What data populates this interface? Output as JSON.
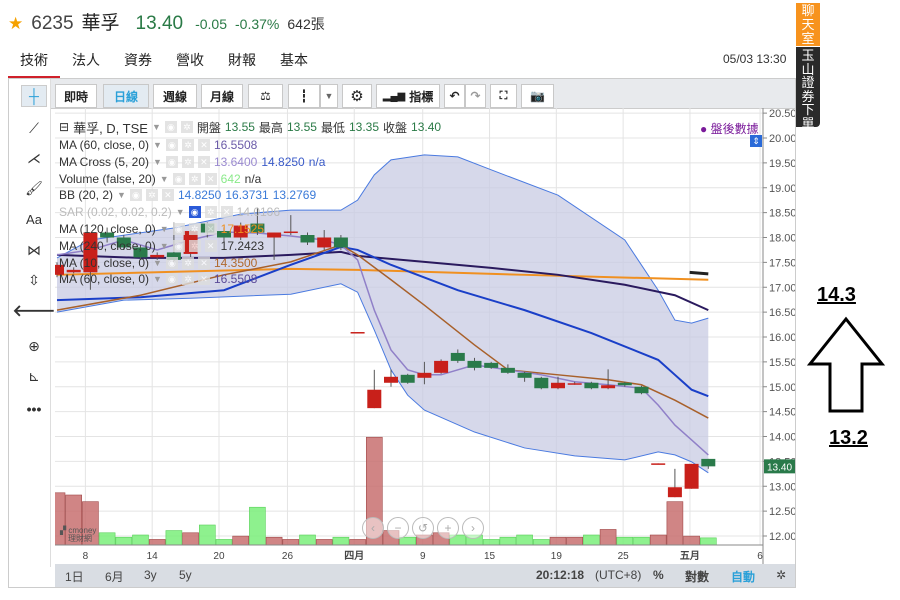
{
  "header": {
    "code": "6235",
    "name": "華孚",
    "price": "13.40",
    "change": "-0.05",
    "change_pct": "-0.37%",
    "volume": "642張"
  },
  "tabs": [
    "技術",
    "法人",
    "資券",
    "營收",
    "財報",
    "基本"
  ],
  "datetime": "05/03 13:30",
  "toolbar": {
    "realtime": "即時",
    "daily": "日線",
    "weekly": "週線",
    "monthly": "月線",
    "indicators": "指標"
  },
  "side": {
    "chat": "聊天室",
    "order": "玉山證券下單"
  },
  "after_hours": "盤後數據",
  "legend": {
    "main": {
      "title": "華孚, D, TSE",
      "open_label": "開盤",
      "open": "13.55",
      "high_label": "最高",
      "high": "13.55",
      "low_label": "最低",
      "low": "13.35",
      "close_label": "收盤",
      "close": "13.40"
    },
    "rows": [
      {
        "name": "MA (60, close, 0)",
        "values": [
          {
            "v": "16.5508",
            "c": "#6a5aa8"
          }
        ]
      },
      {
        "name": "MA Cross (5, 20)",
        "values": [
          {
            "v": "13.6400",
            "c": "#9a8ad0"
          },
          {
            "v": "14.8250",
            "c": "#3a5ac8"
          },
          {
            "v": "n/a",
            "c": "#3a5ac8"
          }
        ]
      },
      {
        "name": "Volume (false, 20)",
        "values": [
          {
            "v": "642",
            "c": "#8aea8a"
          },
          {
            "v": "n/a",
            "c": "#333"
          }
        ]
      },
      {
        "name": "BB (20, 2)",
        "values": [
          {
            "v": "14.8250",
            "c": "#3a7ad8"
          },
          {
            "v": "16.3731",
            "c": "#3a7ad8"
          },
          {
            "v": "13.2769",
            "c": "#3a7ad8"
          }
        ]
      },
      {
        "name": "SAR (0.02, 0.02, 0.2)",
        "values": [
          {
            "v": "14.0106",
            "c": "#bbb"
          }
        ],
        "dim": true
      },
      {
        "name": "MA (120, close, 0)",
        "values": [
          {
            "v": "17.1525",
            "c": "#f09020"
          }
        ]
      },
      {
        "name": "MA (240, close, 0)",
        "values": [
          {
            "v": "17.2423",
            "c": "#333"
          }
        ]
      },
      {
        "name": "MA (10, close, 0)",
        "values": [
          {
            "v": "14.3500",
            "c": "#b06a30"
          }
        ]
      },
      {
        "name": "MA (60, close, 0)",
        "values": [
          {
            "v": "16.5508",
            "c": "#5a4a98"
          }
        ]
      }
    ]
  },
  "bottom": {
    "ranges": [
      "1日",
      "6月",
      "3y",
      "5y"
    ],
    "clock": "20:12:18",
    "tz": "(UTC+8)",
    "pct": "%",
    "log": "對數",
    "auto": "自動"
  },
  "annotations": {
    "high": "14.3",
    "low": "13.2"
  },
  "chart_data": {
    "type": "candlestick",
    "ylim": [
      11.8,
      20.6
    ],
    "y_ticks": [
      "12.00",
      "12.50",
      "13.00",
      "13.50",
      "14.00",
      "14.50",
      "15.00",
      "15.50",
      "16.00",
      "16.50",
      "17.00",
      "17.50",
      "18.00",
      "18.50",
      "19.00",
      "19.50",
      "20.00",
      "20.50"
    ],
    "last_price": "13.40",
    "x_labels": [
      {
        "t": "8",
        "i": 1.7
      },
      {
        "t": "14",
        "i": 5.7
      },
      {
        "t": "20",
        "i": 9.7
      },
      {
        "t": "26",
        "i": 13.8
      },
      {
        "t": "四月",
        "i": 17.8,
        "b": true
      },
      {
        "t": "9",
        "i": 21.9
      },
      {
        "t": "15",
        "i": 25.9
      },
      {
        "t": "19",
        "i": 29.9
      },
      {
        "t": "25",
        "i": 33.9
      },
      {
        "t": "五月",
        "i": 37.9,
        "b": true
      },
      {
        "t": "6",
        "i": 42.1
      }
    ],
    "candles": [
      [
        17.25,
        17.5,
        17.2,
        17.45
      ],
      [
        17.3,
        17.4,
        17.28,
        17.35
      ],
      [
        17.3,
        18.1,
        16.95,
        18.1
      ],
      [
        18.1,
        18.2,
        17.9,
        18.0
      ],
      [
        18.0,
        18.05,
        17.75,
        17.8
      ],
      [
        17.8,
        17.85,
        17.55,
        17.6
      ],
      [
        17.6,
        17.7,
        17.55,
        17.65
      ],
      [
        17.7,
        18.3,
        17.5,
        17.55
      ],
      [
        17.67,
        18.15,
        17.6,
        18.13
      ],
      [
        18.28,
        18.3,
        18.0,
        18.1
      ],
      [
        18.13,
        18.2,
        17.9,
        18.0
      ],
      [
        18.0,
        18.3,
        17.95,
        18.24
      ],
      [
        18.28,
        18.6,
        18.05,
        18.1
      ],
      [
        18.0,
        18.1,
        17.55,
        18.1
      ],
      [
        18.1,
        18.45,
        18.05,
        18.12
      ],
      [
        18.05,
        18.1,
        17.85,
        17.9
      ],
      [
        17.8,
        18.15,
        17.75,
        18.0
      ],
      [
        18.0,
        18.05,
        17.75,
        17.8
      ],
      [
        16.08,
        16.1,
        16.08,
        16.1
      ],
      [
        14.57,
        15.34,
        14.57,
        14.94
      ],
      [
        15.08,
        15.35,
        15.0,
        15.2
      ],
      [
        15.24,
        15.26,
        15.06,
        15.08
      ],
      [
        15.18,
        15.5,
        15.05,
        15.28
      ],
      [
        15.28,
        15.55,
        15.26,
        15.52
      ],
      [
        15.68,
        15.75,
        15.48,
        15.52
      ],
      [
        15.52,
        15.58,
        15.33,
        15.38
      ],
      [
        15.48,
        15.5,
        15.36,
        15.38
      ],
      [
        15.38,
        15.45,
        15.26,
        15.28
      ],
      [
        15.28,
        15.3,
        15.1,
        15.18
      ],
      [
        15.18,
        15.2,
        14.95,
        14.97
      ],
      [
        14.97,
        15.2,
        14.95,
        15.08
      ],
      [
        15.07,
        15.1,
        15.04,
        15.07
      ],
      [
        15.08,
        15.1,
        14.95,
        14.97
      ],
      [
        14.97,
        15.35,
        14.95,
        15.03
      ],
      [
        15.08,
        15.1,
        15.0,
        15.03
      ],
      [
        15.0,
        15.02,
        14.85,
        14.87
      ],
      [
        13.44,
        13.46,
        13.44,
        13.46
      ],
      [
        12.78,
        13.35,
        12.78,
        12.98
      ],
      [
        12.95,
        13.45,
        12.95,
        13.45
      ],
      [
        13.55,
        13.55,
        13.35,
        13.4
      ]
    ],
    "volume": [
      4700,
      4500,
      3900,
      1100,
      700,
      900,
      500,
      1300,
      1100,
      1800,
      500,
      800,
      3400,
      700,
      500,
      900,
      500,
      700,
      500,
      9700,
      1300,
      700,
      900,
      1100,
      900,
      900,
      500,
      700,
      900,
      500,
      700,
      700,
      900,
      1400,
      700,
      700,
      900,
      3900,
      800,
      642
    ],
    "series": [
      {
        "name": "BB upper",
        "color": "#4a7ae0",
        "w": 1,
        "pts": [
          [
            0,
            17.59
          ],
          [
            2,
            17.95
          ],
          [
            7,
            18.19
          ],
          [
            11,
            18.47
          ],
          [
            14,
            18.55
          ],
          [
            17,
            18.55
          ],
          [
            18,
            18.75
          ],
          [
            19,
            19.26
          ],
          [
            20,
            19.56
          ],
          [
            22,
            19.66
          ],
          [
            24,
            19.62
          ],
          [
            26,
            19.36
          ],
          [
            30,
            18.85
          ],
          [
            34,
            17.95
          ],
          [
            36,
            16.94
          ],
          [
            37,
            16.34
          ],
          [
            38,
            16.28
          ],
          [
            39,
            16.38
          ]
        ]
      },
      {
        "name": "BB lower",
        "color": "#4a7ae0",
        "w": 1,
        "pts": [
          [
            0,
            16.5
          ],
          [
            4,
            16.74
          ],
          [
            8,
            16.78
          ],
          [
            14,
            16.86
          ],
          [
            17,
            17.07
          ],
          [
            18,
            16.9
          ],
          [
            19,
            16.14
          ],
          [
            20,
            15.34
          ],
          [
            21,
            14.83
          ],
          [
            22,
            14.53
          ],
          [
            25,
            14.09
          ],
          [
            28,
            13.77
          ],
          [
            31,
            13.61
          ],
          [
            34,
            13.53
          ],
          [
            36,
            13.69
          ],
          [
            37,
            13.63
          ],
          [
            38,
            13.49
          ],
          [
            39,
            13.27
          ]
        ]
      },
      {
        "name": "MA 120",
        "color": "#f09020",
        "w": 2,
        "pts": [
          [
            0,
            17.25
          ],
          [
            14,
            17.37
          ],
          [
            18,
            17.35
          ],
          [
            28,
            17.25
          ],
          [
            39,
            17.15
          ]
        ]
      },
      {
        "name": "MA 60",
        "color": "#2a1a5e",
        "w": 2,
        "pts": [
          [
            0,
            17.65
          ],
          [
            5,
            17.59
          ],
          [
            10,
            17.59
          ],
          [
            14,
            17.65
          ],
          [
            17,
            17.71
          ],
          [
            18,
            17.63
          ],
          [
            22,
            17.51
          ],
          [
            26,
            17.39
          ],
          [
            30,
            17.25
          ],
          [
            34,
            17.05
          ],
          [
            37,
            16.84
          ],
          [
            39,
            16.54
          ]
        ]
      },
      {
        "name": "MA 20",
        "color": "#1a3fc8",
        "w": 2,
        "pts": [
          [
            0,
            16.74
          ],
          [
            5,
            16.8
          ],
          [
            10,
            16.94
          ],
          [
            14,
            17.45
          ],
          [
            17,
            17.81
          ],
          [
            18,
            17.75
          ],
          [
            20,
            17.45
          ],
          [
            24,
            16.94
          ],
          [
            28,
            16.54
          ],
          [
            32,
            16.08
          ],
          [
            36,
            15.54
          ],
          [
            37,
            15.24
          ],
          [
            38,
            14.94
          ],
          [
            39,
            14.81
          ]
        ]
      },
      {
        "name": "MA 10",
        "color": "#a8602a",
        "w": 1.5,
        "pts": [
          [
            0,
            16.54
          ],
          [
            5,
            16.84
          ],
          [
            10,
            17.25
          ],
          [
            14,
            17.51
          ],
          [
            17,
            17.85
          ],
          [
            18,
            17.65
          ],
          [
            20,
            17.15
          ],
          [
            22,
            16.64
          ],
          [
            25,
            15.84
          ],
          [
            27,
            15.34
          ],
          [
            30,
            15.24
          ],
          [
            33,
            15.14
          ],
          [
            35,
            15.04
          ],
          [
            37,
            14.73
          ],
          [
            39,
            14.37
          ]
        ]
      },
      {
        "name": "MA 5",
        "color": "#9080c8",
        "w": 1.5,
        "pts": [
          [
            0,
            17.65
          ],
          [
            2,
            17.75
          ],
          [
            4,
            17.95
          ],
          [
            6,
            17.75
          ],
          [
            8,
            17.95
          ],
          [
            10,
            18.11
          ],
          [
            12,
            18.09
          ],
          [
            14,
            18.03
          ],
          [
            16,
            17.95
          ],
          [
            17,
            17.85
          ],
          [
            18,
            17.55
          ],
          [
            19,
            16.54
          ],
          [
            20,
            15.74
          ],
          [
            21,
            15.34
          ],
          [
            22,
            15.24
          ],
          [
            23,
            15.24
          ],
          [
            25,
            15.44
          ],
          [
            27,
            15.34
          ],
          [
            29,
            15.24
          ],
          [
            31,
            15.1
          ],
          [
            33,
            15.04
          ],
          [
            35,
            14.97
          ],
          [
            36,
            14.63
          ],
          [
            37,
            14.23
          ],
          [
            38,
            13.93
          ],
          [
            39,
            13.63
          ]
        ]
      }
    ],
    "colors": {
      "up": "#c8201a",
      "down": "#2a7a4a",
      "band": "#c8cbe3",
      "vol_up": "#c87070",
      "vol_down": "#7aee7a",
      "last_bg": "#2a7a4a"
    }
  }
}
